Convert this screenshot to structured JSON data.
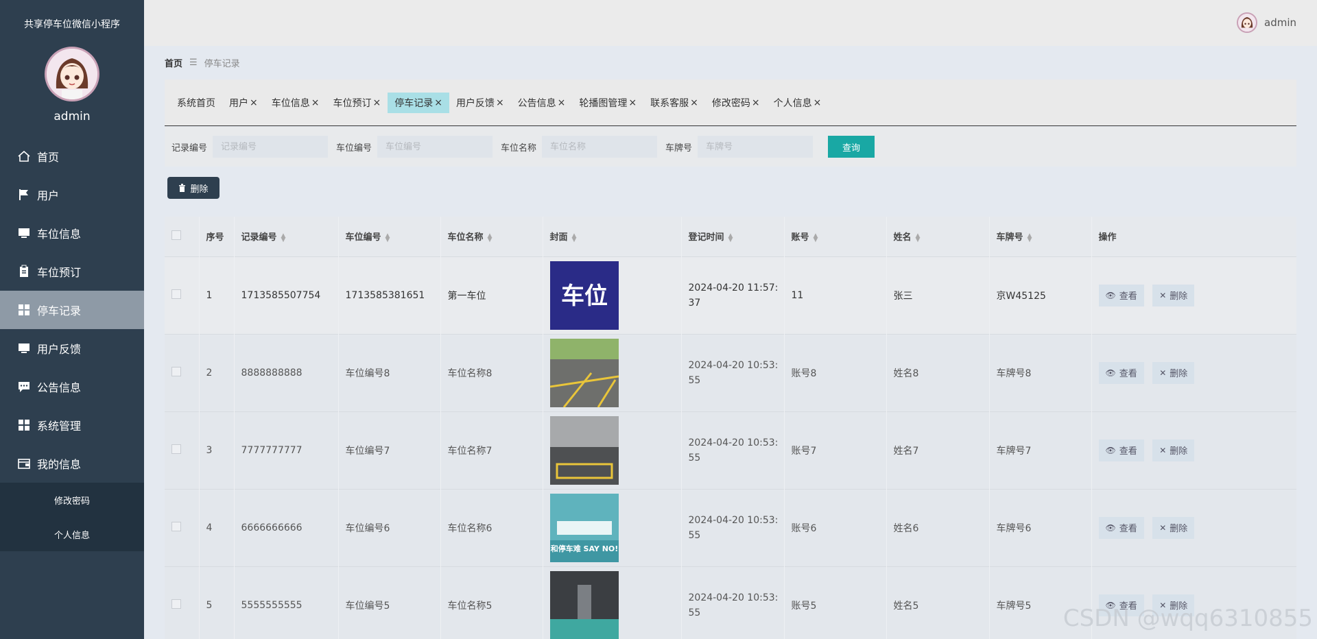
{
  "sidebar": {
    "app_title": "共享停车位微信小程序",
    "username": "admin",
    "menu": [
      {
        "label": "首页",
        "icon": "home-icon"
      },
      {
        "label": "用户",
        "icon": "flag-icon"
      },
      {
        "label": "车位信息",
        "icon": "monitor-icon"
      },
      {
        "label": "车位预订",
        "icon": "clipboard-icon"
      },
      {
        "label": "停车记录",
        "icon": "grid-icon"
      },
      {
        "label": "用户反馈",
        "icon": "monitor-icon"
      },
      {
        "label": "公告信息",
        "icon": "chat-icon"
      },
      {
        "label": "系统管理",
        "icon": "grid-icon"
      },
      {
        "label": "我的信息",
        "icon": "wallet-icon"
      }
    ],
    "submenu": [
      "修改密码",
      "个人信息"
    ]
  },
  "topbar": {
    "username": "admin"
  },
  "breadcrumb": {
    "home": "首页",
    "separator": "☰",
    "current": "停车记录"
  },
  "tabs": [
    "系统首页",
    "用户",
    "车位信息",
    "车位预订",
    "停车记录",
    "用户反馈",
    "公告信息",
    "轮播图管理",
    "联系客服",
    "修改密码",
    "个人信息"
  ],
  "search": {
    "fields": [
      {
        "label": "记录编号",
        "placeholder": "记录编号"
      },
      {
        "label": "车位编号",
        "placeholder": "车位编号"
      },
      {
        "label": "车位名称",
        "placeholder": "车位名称"
      },
      {
        "label": "车牌号",
        "placeholder": "车牌号"
      }
    ],
    "button": "查询"
  },
  "toolbar": {
    "delete_label": "删除"
  },
  "table": {
    "headers": [
      "序号",
      "记录编号",
      "车位编号",
      "车位名称",
      "封面",
      "登记时间",
      "账号",
      "姓名",
      "车牌号",
      "操作"
    ],
    "view_label": "查看",
    "delete_label": "删除",
    "rows": [
      {
        "no": "1",
        "record": "1713585507754",
        "spot_no": "1713585381651",
        "spot_name": "第一车位",
        "cover_text": "车位",
        "time_a": "2024-04-20 11:57:",
        "time_b": "37",
        "account": "11",
        "name": "张三",
        "plate": "京W45125"
      },
      {
        "no": "2",
        "record": "8888888888",
        "spot_no": "车位编号8",
        "spot_name": "车位名称8",
        "cover_text": "",
        "time_a": "2024-04-20 10:53:",
        "time_b": "55",
        "account": "账号8",
        "name": "姓名8",
        "plate": "车牌号8"
      },
      {
        "no": "3",
        "record": "7777777777",
        "spot_no": "车位编号7",
        "spot_name": "车位名称7",
        "cover_text": "",
        "time_a": "2024-04-20 10:53:",
        "time_b": "55",
        "account": "账号7",
        "name": "姓名7",
        "plate": "车牌号7"
      },
      {
        "no": "4",
        "record": "6666666666",
        "spot_no": "车位编号6",
        "spot_name": "车位名称6",
        "cover_text": "和停车难 SAY NO!",
        "time_a": "2024-04-20 10:53:",
        "time_b": "55",
        "account": "账号6",
        "name": "姓名6",
        "plate": "车牌号6"
      },
      {
        "no": "5",
        "record": "5555555555",
        "spot_no": "车位编号5",
        "spot_name": "车位名称5",
        "cover_text": "",
        "time_a": "2024-04-20 10:53:",
        "time_b": "55",
        "account": "账号5",
        "name": "姓名5",
        "plate": "车牌号5"
      }
    ]
  },
  "watermark": "CSDN @wqq6310855"
}
